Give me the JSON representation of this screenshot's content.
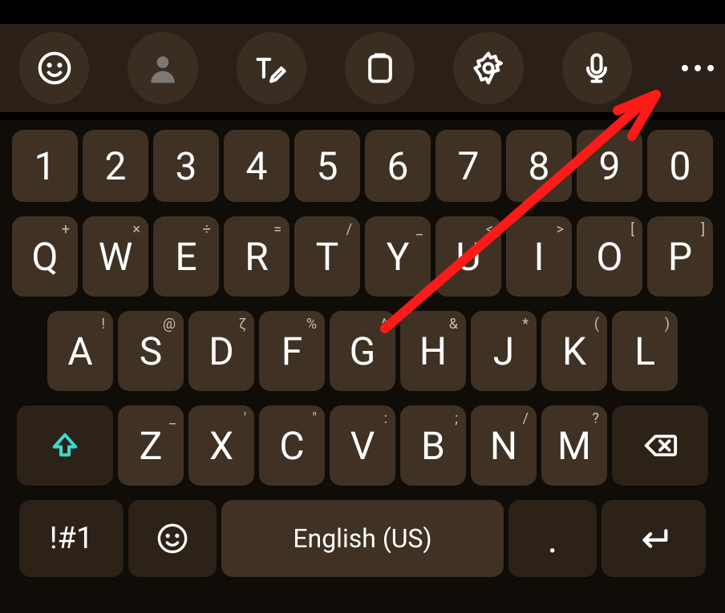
{
  "toolbar": {
    "icons": [
      "smiley",
      "avatar",
      "text-edit",
      "clipboard",
      "settings",
      "mic",
      "more"
    ]
  },
  "row1": [
    "1",
    "2",
    "3",
    "4",
    "5",
    "6",
    "7",
    "8",
    "9",
    "0"
  ],
  "row2": {
    "main": [
      "Q",
      "W",
      "E",
      "R",
      "T",
      "Y",
      "U",
      "I",
      "O",
      "P"
    ],
    "sec": [
      "+",
      "×",
      "÷",
      "=",
      "/",
      "_",
      "<",
      ">",
      "[",
      "]"
    ]
  },
  "row3": {
    "main": [
      "A",
      "S",
      "D",
      "F",
      "G",
      "H",
      "J",
      "K",
      "L"
    ],
    "sec": [
      "!",
      "@",
      "ζ",
      "%",
      "^",
      "&",
      "*",
      "(",
      ")"
    ]
  },
  "row4": {
    "main": [
      "Z",
      "X",
      "C",
      "V",
      "B",
      "N",
      "M"
    ],
    "sec": [
      "_",
      "'",
      "\"",
      ":",
      ";",
      "/",
      "?"
    ]
  },
  "row5": {
    "symbols": "!#1",
    "space": "English (US)",
    "period": "."
  }
}
